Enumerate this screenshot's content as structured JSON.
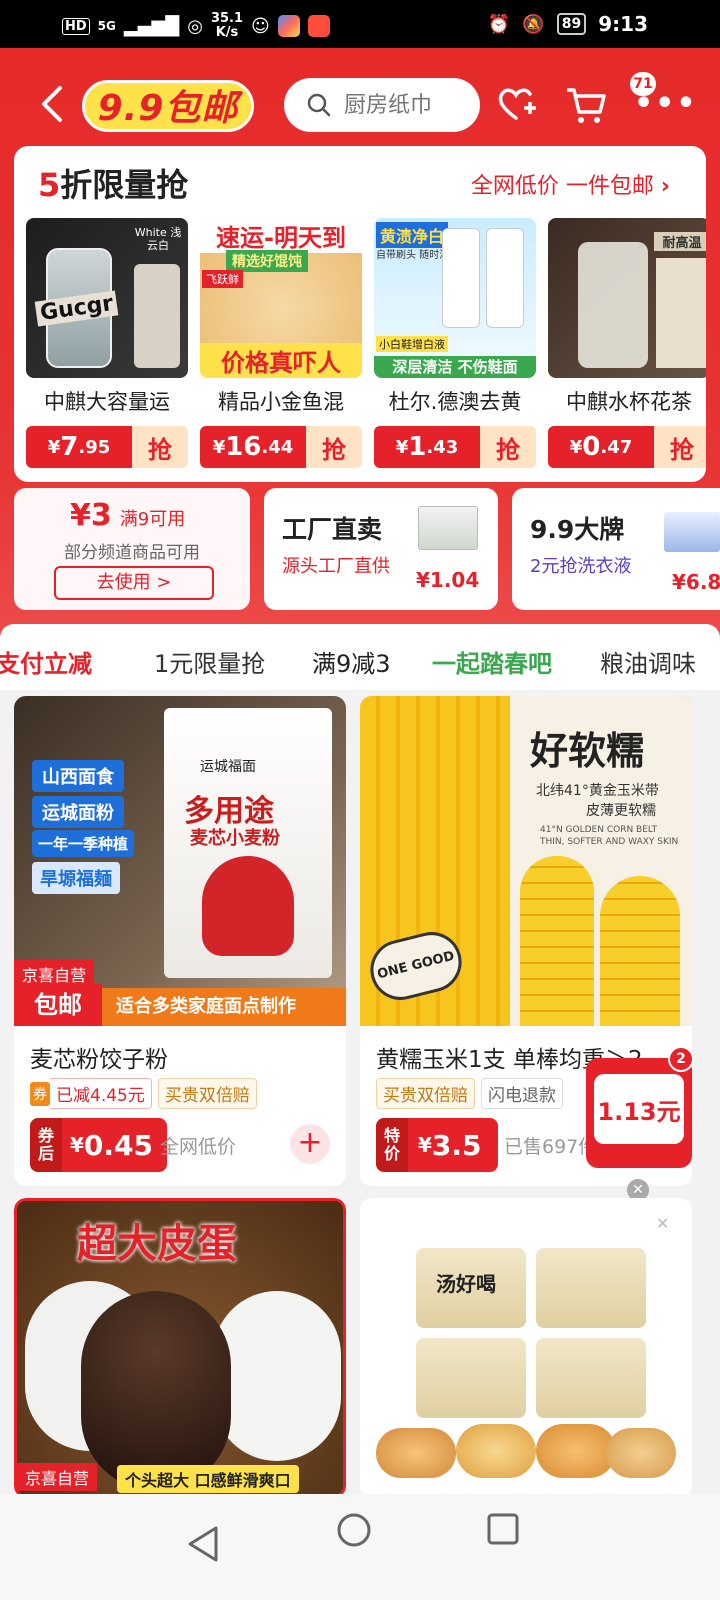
{
  "status_bar": {
    "network": "5G",
    "speed": "35.1",
    "speed_unit": "K/s",
    "battery": "89",
    "time": "9:13"
  },
  "header": {
    "logo_text": "9.9包邮",
    "search_placeholder": "厨房纸巾",
    "cart_count": "71"
  },
  "flash_sale": {
    "title_num": "5",
    "title_text": "折限量抢",
    "more_label": "全网低价 一件包邮",
    "items": [
      {
        "name": "中麒大容量运",
        "currency": "¥",
        "price_int": "7",
        "price_dec": ".95",
        "grab": "抢",
        "overlay": "Gucgr",
        "badge": "White 浅云白"
      },
      {
        "name": "精品小金鱼混",
        "currency": "¥",
        "price_int": "16",
        "price_dec": ".44",
        "grab": "抢",
        "overlay_top": "速运-明天到",
        "overlay_mid": "精选好馄饨",
        "overlay_bottom": "价格真吓人",
        "label": "飞跃鲜"
      },
      {
        "name": "杜尔.德澳去黄",
        "currency": "¥",
        "price_int": "1",
        "price_dec": ".43",
        "grab": "抢",
        "overlay_top": "黄渍净白",
        "overlay_sub": "自带刷头 随时洁净",
        "overlay_bottom": "深层清洁 不伤鞋面",
        "overlay_small": "小白鞋增白液"
      },
      {
        "name": "中麒水杯花茶",
        "currency": "¥",
        "price_int": "0",
        "price_dec": ".47",
        "grab": "抢",
        "overlay": "耐高温"
      }
    ]
  },
  "promos": {
    "coupon": {
      "amount": "¥3",
      "condition": "满9可用",
      "desc": "部分频道商品可用",
      "button": "去使用 >"
    },
    "factory": {
      "title": "工厂直卖",
      "sub": "源头工厂直供",
      "price": "¥1.04"
    },
    "brand": {
      "title": "9.9大牌",
      "sub": "2元抢洗衣液",
      "price": "¥6.8"
    }
  },
  "tabs": [
    {
      "label": "支付立减",
      "color": "#e5212a"
    },
    {
      "label": "1元限量抢",
      "color": "#333333"
    },
    {
      "label": "满9减3",
      "color": "#222222"
    },
    {
      "label": "一起踏春吧",
      "color": "#3aa84e"
    },
    {
      "label": "粮油调味",
      "color": "#333333"
    }
  ],
  "products": [
    {
      "title": "麦芯粉饺子粉",
      "img_labels": [
        "山西面食",
        "运城面粉",
        "一年一季种植",
        "旱塬福麺"
      ],
      "bag_title": "多用途",
      "bag_sub": "麦芯小麦粉",
      "bag_brand": "运城福面",
      "self_badge": "京喜自营",
      "ship_badge": "包邮",
      "banner": "适合多类家庭面点制作",
      "coupon_icon": "券",
      "tag1": "已减4.45元",
      "tag2": "买贵双倍赔",
      "price_label": "券后",
      "currency": "¥",
      "price": "0.45",
      "note": "全网低价"
    },
    {
      "title": "黄糯玉米1支 单棒均重＞2",
      "img_title": "好软糯",
      "img_sub": "北纬41°黄金玉米带",
      "img_sub2": "皮薄更软糯",
      "img_en": "41°N GOLDEN CORN BELT THIN, SOFTER AND WAXY SKIN",
      "stamp": "ONE GOOD",
      "tag1": "买贵双倍赔",
      "tag2": "闪电退款",
      "price_label": "特价",
      "currency": "¥",
      "price": "3.5",
      "note": "已售697件"
    },
    {
      "img_title": "超大皮蛋",
      "self_badge": "京喜自营",
      "banner": "个头超大 口感鲜滑爽口"
    },
    {
      "img_brand": "汤好喝"
    }
  ],
  "float_cart": {
    "count": "2",
    "amount": "1.13元"
  },
  "colors": {
    "primary": "#e5212a",
    "accent_yellow": "#ffe14a",
    "green": "#3aa84e",
    "blue": "#1e6fd9"
  }
}
